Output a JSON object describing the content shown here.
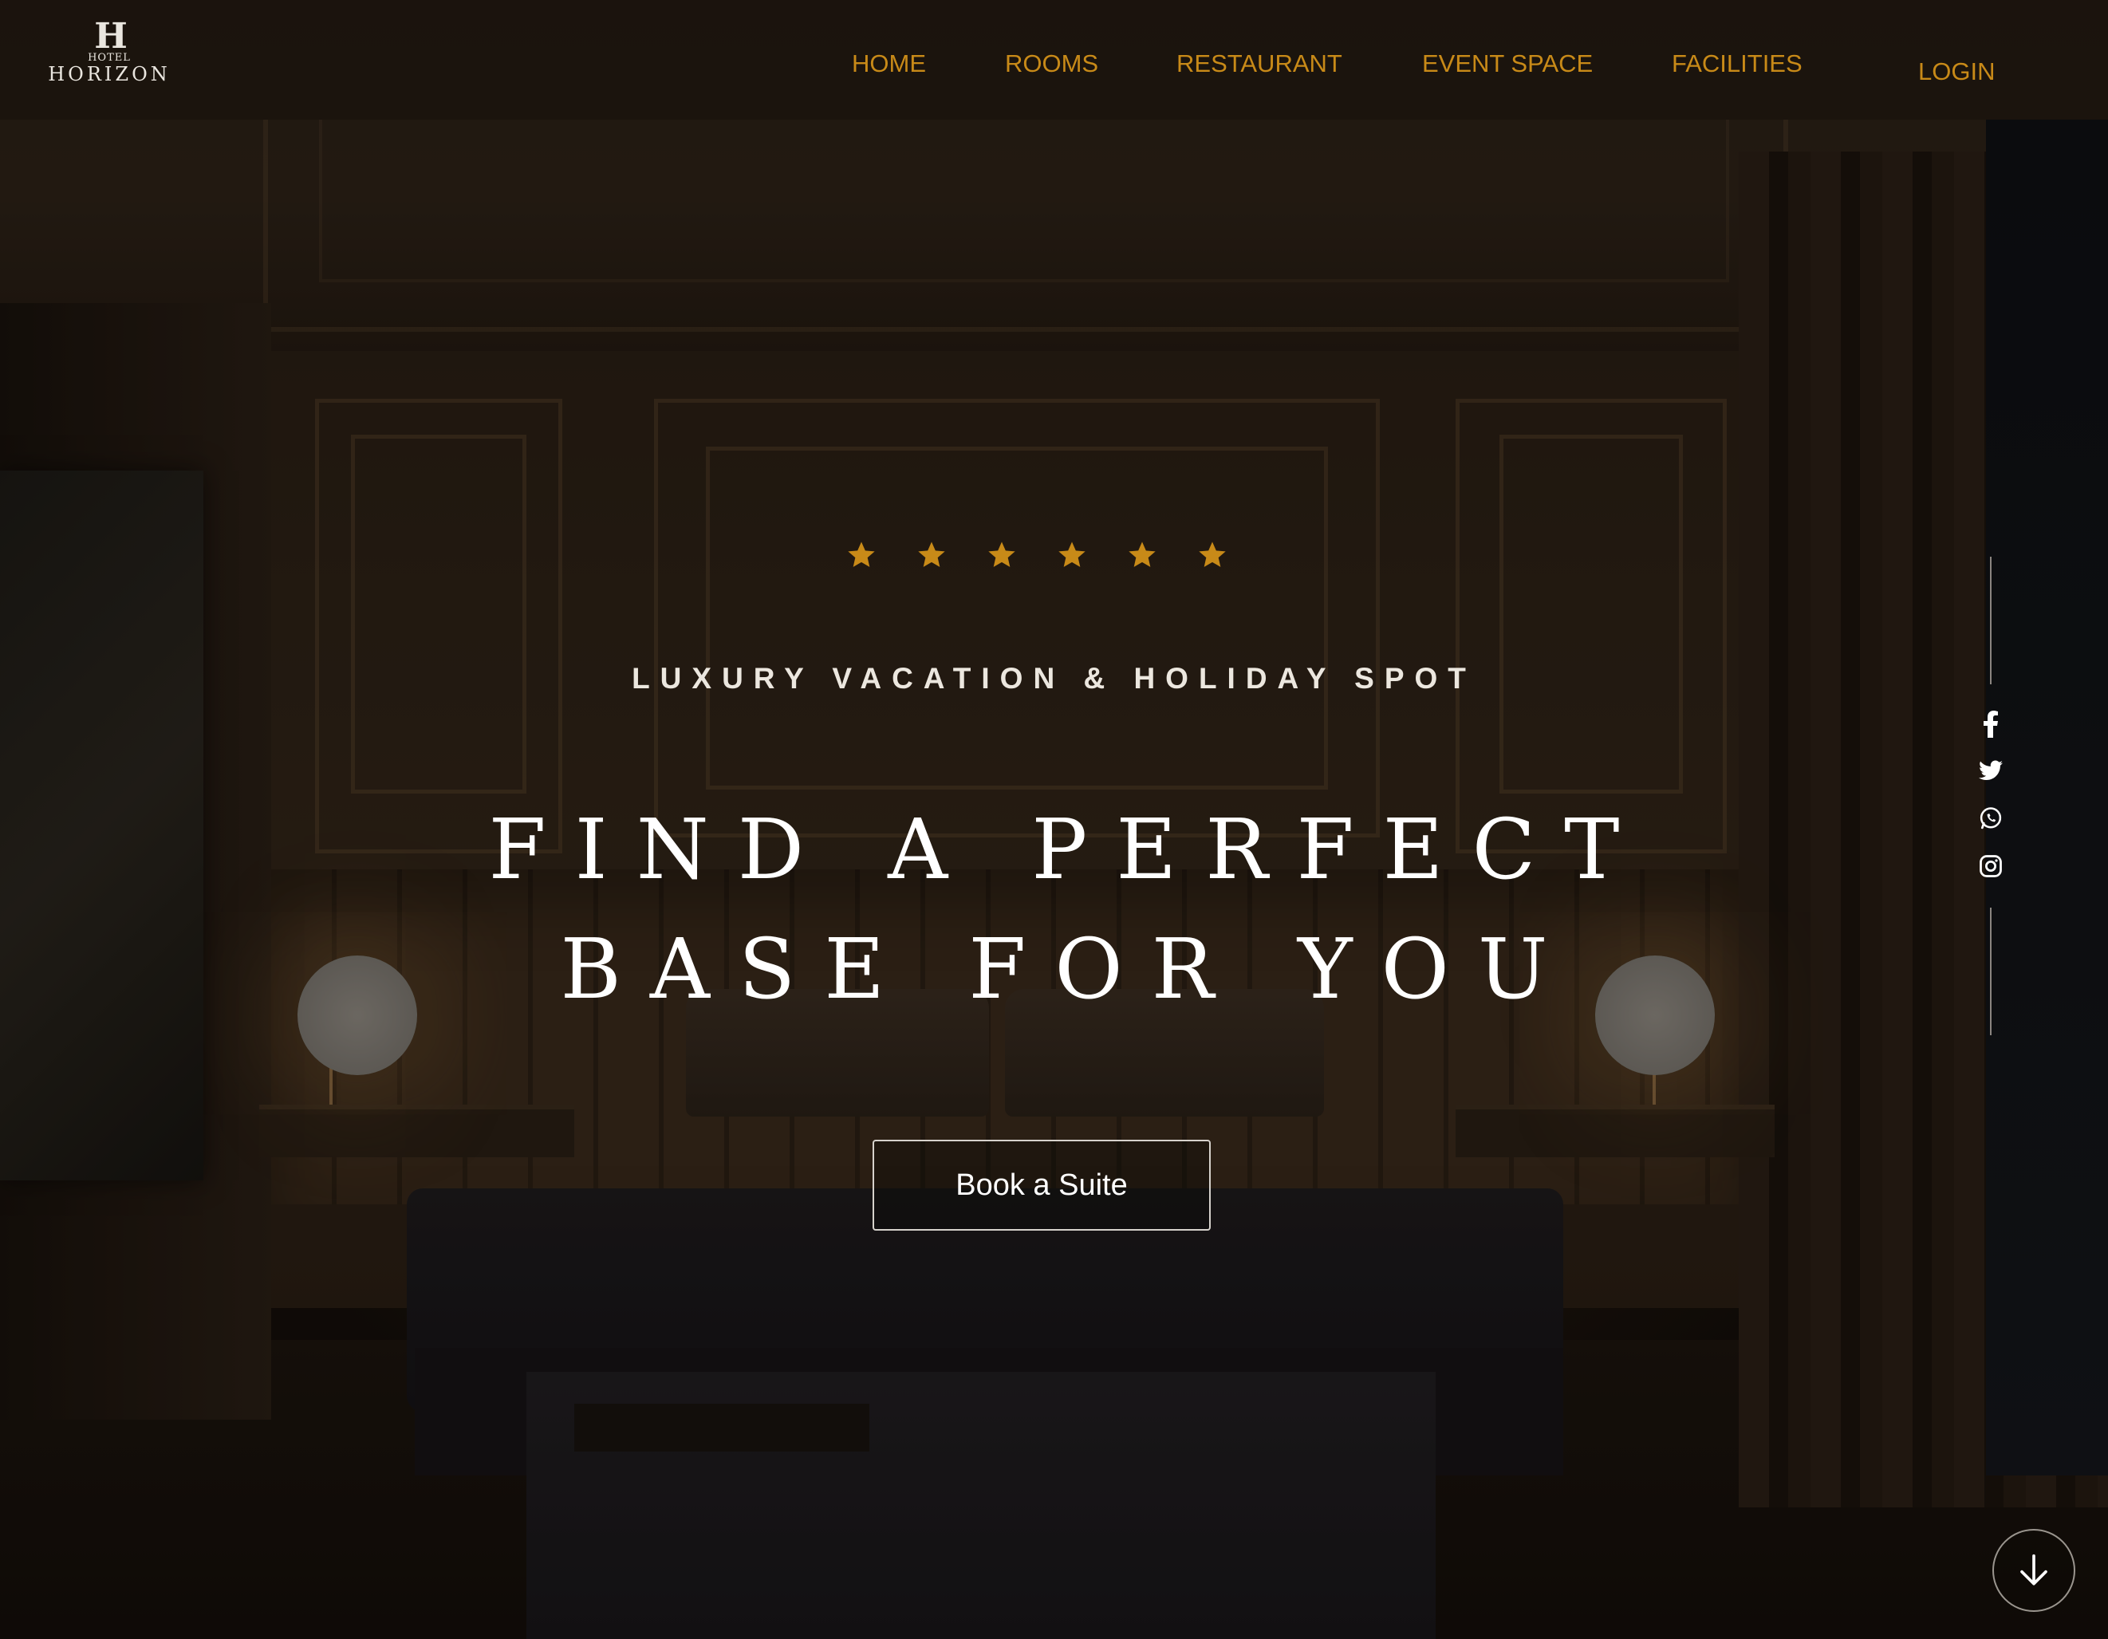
{
  "brand": {
    "logo_mark": "H",
    "logo_small": "HOTEL",
    "logo_name": "HORIZON"
  },
  "nav": {
    "items": [
      {
        "label": "HOME"
      },
      {
        "label": "ROOMS"
      },
      {
        "label": "RESTAURANT"
      },
      {
        "label": "EVENT SPACE"
      },
      {
        "label": "FACILITIES"
      }
    ],
    "login_label": "LOGIN"
  },
  "hero": {
    "rating_stars": 6,
    "star_icon": "star-icon",
    "tagline": "LUXURY VACATION & HOLIDAY SPOT",
    "headline_line1": "FIND A PERFECT",
    "headline_line2": "BASE FOR YOU",
    "cta_label": "Book a Suite"
  },
  "social": {
    "icons": [
      "facebook-icon",
      "twitter-icon",
      "whatsapp-icon",
      "instagram-icon"
    ]
  },
  "scroll": {
    "icon": "arrow-down-icon"
  },
  "colors": {
    "accent": "#c88a18",
    "text_light": "#ffffff",
    "header_bg": "#18110b"
  }
}
